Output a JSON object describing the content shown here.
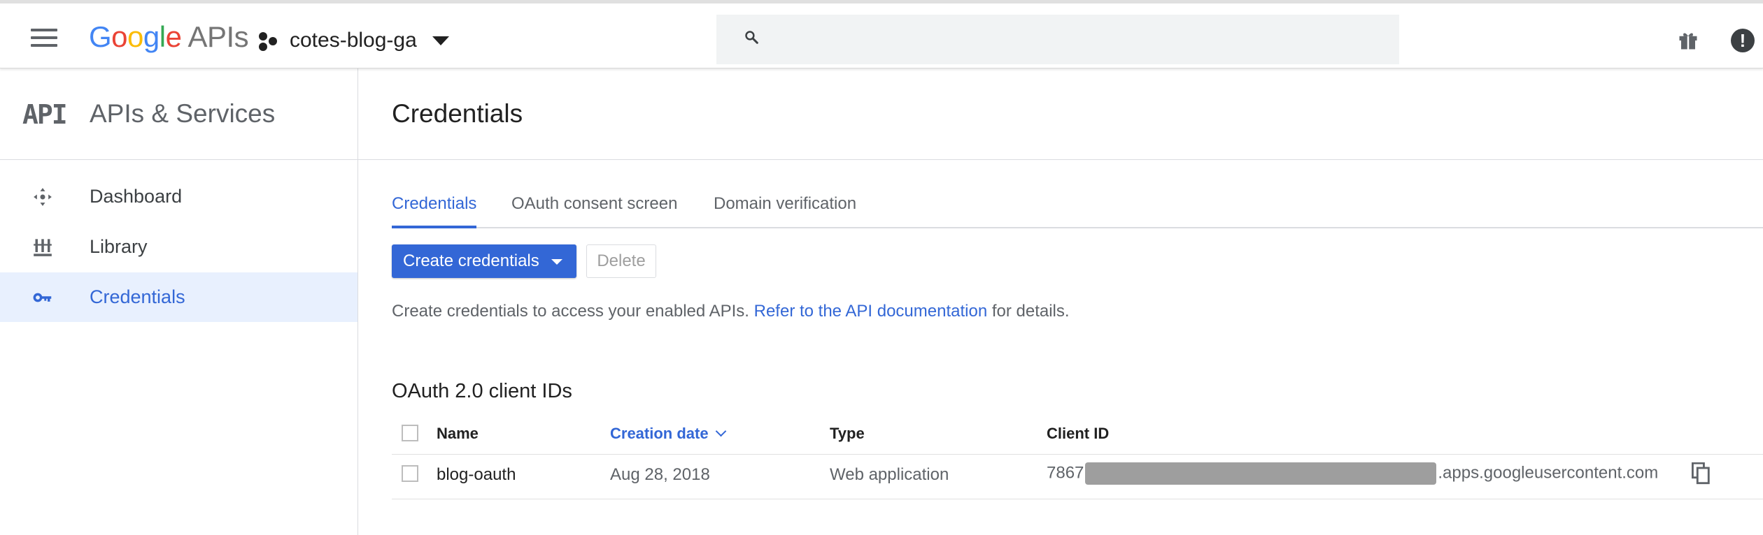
{
  "header": {
    "logo": [
      "G",
      "o",
      "o",
      "g",
      "l",
      "e"
    ],
    "logo_product": "APIs",
    "project_name": "cotes-blog-ga",
    "search_placeholder": "",
    "icons": [
      "menu-icon",
      "project-icon",
      "search-icon",
      "gift-icon",
      "alert-icon"
    ]
  },
  "sidebar": {
    "title": "APIs & Services",
    "logo_text": "API",
    "items": [
      {
        "label": "Dashboard",
        "icon": "dashboard-icon",
        "active": false
      },
      {
        "label": "Library",
        "icon": "library-icon",
        "active": false
      },
      {
        "label": "Credentials",
        "icon": "key-icon",
        "active": true
      }
    ]
  },
  "main": {
    "title": "Credentials",
    "tabs": [
      {
        "label": "Credentials",
        "active": true
      },
      {
        "label": "OAuth consent screen",
        "active": false
      },
      {
        "label": "Domain verification",
        "active": false
      }
    ],
    "create_button": "Create credentials",
    "delete_button": "Delete",
    "help_before": "Create credentials to access your enabled APIs. ",
    "help_link": "Refer to the API documentation",
    "help_after": " for details.",
    "section_title": "OAuth 2.0 client IDs",
    "table": {
      "columns": [
        "Name",
        "Creation date",
        "Type",
        "Client ID"
      ],
      "sorted_column": "Creation date",
      "rows": [
        {
          "name": "blog-oauth",
          "creation_date": "Aug 28, 2018",
          "type": "Web application",
          "client_id_prefix": "7867",
          "client_id_suffix": ".apps.googleusercontent.com"
        }
      ]
    }
  },
  "colors": {
    "accent": "#3367d6",
    "active_nav_bg": "#e8f0fe",
    "redaction": "#9e9e9e"
  }
}
